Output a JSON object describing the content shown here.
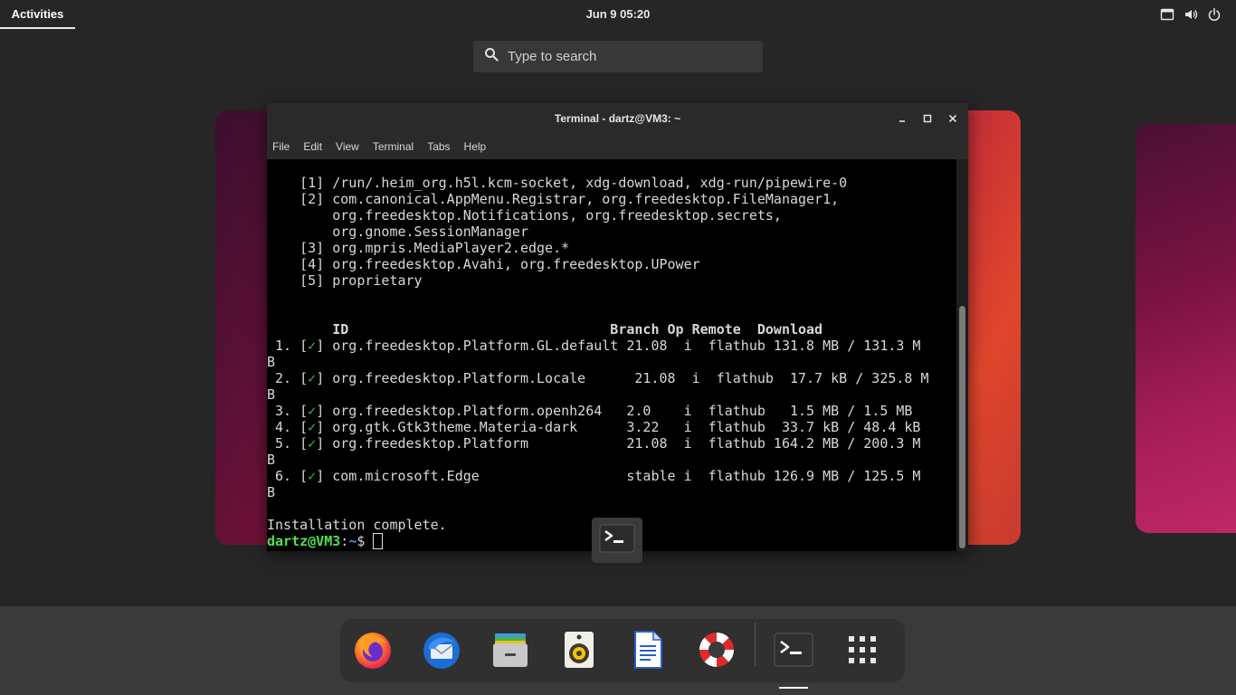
{
  "topbar": {
    "activities_label": "Activities",
    "clock": "Jun 9  05:20",
    "icons": [
      "network-icon",
      "volume-icon",
      "power-icon"
    ]
  },
  "search": {
    "placeholder": "Type to search"
  },
  "terminal": {
    "title": "Terminal - dartz@VM3: ~",
    "menu": [
      "File",
      "Edit",
      "View",
      "Terminal",
      "Tabs",
      "Help"
    ],
    "perm_lines": [
      "    [1] /run/.heim_org.h5l.kcm-socket, xdg-download, xdg-run/pipewire-0",
      "    [2] com.canonical.AppMenu.Registrar, org.freedesktop.FileManager1,",
      "        org.freedesktop.Notifications, org.freedesktop.secrets,",
      "        org.gnome.SessionManager",
      "    [3] org.mpris.MediaPlayer2.edge.*",
      "    [4] org.freedesktop.Avahi, org.freedesktop.UPower",
      "    [5] proprietary"
    ],
    "table_header": "        ID                                Branch Op Remote  Download",
    "rows": [
      {
        "num": " 1.",
        "id": "org.freedesktop.Platform.GL.default",
        "rest": " 21.08  i  flathub 131.8 MB / 131.3 M",
        "wrap": "B"
      },
      {
        "num": " 2.",
        "id": "org.freedesktop.Platform.Locale     ",
        "rest": " 21.08  i  flathub  17.7 kB / 325.8 M",
        "wrap": "B"
      },
      {
        "num": " 3.",
        "id": "org.freedesktop.Platform.openh264   ",
        "rest": "2.0    i  flathub   1.5 MB / 1.5 MB",
        "wrap": null
      },
      {
        "num": " 4.",
        "id": "org.gtk.Gtk3theme.Materia-dark      ",
        "rest": "3.22   i  flathub  33.7 kB / 48.4 kB",
        "wrap": null
      },
      {
        "num": " 5.",
        "id": "org.freedesktop.Platform            ",
        "rest": "21.08  i  flathub 164.2 MB / 200.3 M",
        "wrap": "B"
      },
      {
        "num": " 6.",
        "id": "com.microsoft.Edge                  ",
        "rest": "stable i  flathub 126.9 MB / 125.5 M",
        "wrap": "B"
      }
    ],
    "check_mark": "✓",
    "status": "Installation complete.",
    "prompt_user": "dartz@VM3",
    "prompt_sep": ":",
    "prompt_path": "~",
    "prompt_sign": "$ "
  },
  "dock": {
    "apps": [
      "firefox-icon",
      "thunderbird-icon",
      "files-icon",
      "rhythmbox-icon",
      "writer-icon",
      "help-icon",
      "terminal-icon",
      "show-apps-icon"
    ]
  },
  "colors": {
    "accent_green": "#4ee24e",
    "path_blue": "#5c8cf0",
    "panel_bg": "#262626"
  }
}
